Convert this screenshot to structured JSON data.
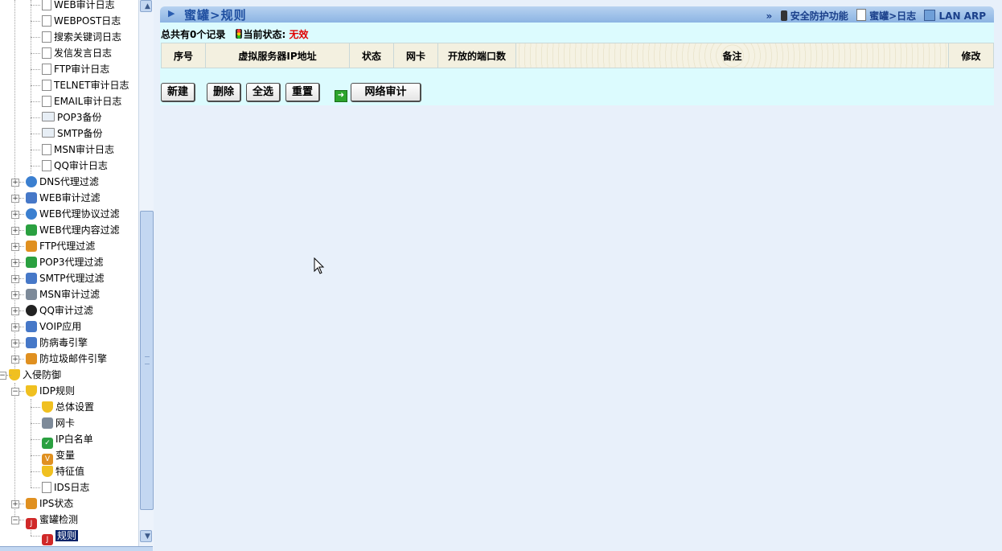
{
  "tree": {
    "items": [
      {
        "label": "WEB审计日志",
        "icon": "document-icon",
        "level": 3
      },
      {
        "label": "WEBPOST日志",
        "icon": "document-icon",
        "level": 3
      },
      {
        "label": "搜索关键词日志",
        "icon": "document-icon",
        "level": 3
      },
      {
        "label": "发信发言日志",
        "icon": "document-icon",
        "level": 3
      },
      {
        "label": "FTP审计日志",
        "icon": "document-icon",
        "level": 3
      },
      {
        "label": "TELNET审计日志",
        "icon": "document-icon",
        "level": 3
      },
      {
        "label": "EMAIL审计日志",
        "icon": "document-icon",
        "level": 3
      },
      {
        "label": "POP3备份",
        "icon": "envelope-icon",
        "level": 3
      },
      {
        "label": "SMTP备份",
        "icon": "envelope-icon",
        "level": 3
      },
      {
        "label": "MSN审计日志",
        "icon": "document-icon",
        "level": 3
      },
      {
        "label": "QQ审计日志",
        "icon": "document-icon",
        "level": 3
      },
      {
        "label": "DNS代理过滤",
        "icon": "globe-icon",
        "level": 2
      },
      {
        "label": "WEB审计过滤",
        "icon": "computer-icon",
        "level": 2
      },
      {
        "label": "WEB代理协议过滤",
        "icon": "globe-search-icon",
        "level": 2
      },
      {
        "label": "WEB代理内容过滤",
        "icon": "magnifier-icon",
        "level": 2
      },
      {
        "label": "FTP代理过滤",
        "icon": "ftp-icon",
        "level": 2
      },
      {
        "label": "POP3代理过滤",
        "icon": "mailbox-icon",
        "level": 2
      },
      {
        "label": "SMTP代理过滤",
        "icon": "mail-send-icon",
        "level": 2
      },
      {
        "label": "MSN审计过滤",
        "icon": "msn-user-icon",
        "level": 2
      },
      {
        "label": "QQ审计过滤",
        "icon": "qq-icon",
        "level": 2
      },
      {
        "label": "VOIP应用",
        "icon": "phone-icon",
        "level": 2
      },
      {
        "label": "防病毒引擎",
        "icon": "antivirus-shield-icon",
        "level": 2
      },
      {
        "label": "防垃圾邮件引擎",
        "icon": "antispam-icon",
        "level": 2
      },
      {
        "label": "入侵防御",
        "icon": "shield-icon",
        "level": 1
      },
      {
        "label": "IDP规则",
        "icon": "shield-icon",
        "level": 2
      },
      {
        "label": "总体设置",
        "icon": "shield-icon",
        "level": 3
      },
      {
        "label": "网卡",
        "icon": "network-card-icon",
        "level": 3
      },
      {
        "label": "IP白名单",
        "icon": "checkbox-icon",
        "level": 3
      },
      {
        "label": "变量",
        "icon": "variable-icon",
        "level": 3
      },
      {
        "label": "特征值",
        "icon": "signature-icon",
        "level": 3
      },
      {
        "label": "IDS日志",
        "icon": "document-icon",
        "level": 3
      },
      {
        "label": "IPS状态",
        "icon": "ips-status-icon",
        "level": 2
      },
      {
        "label": "蜜罐检测",
        "icon": "honeypot-icon",
        "level": 2
      },
      {
        "label": "规则",
        "icon": "honeypot-icon",
        "level": 3
      }
    ]
  },
  "header": {
    "title": "蜜罐>规则",
    "link_prefix": "»",
    "link_security": "安全防护功能",
    "link_log": "蜜罐>日志",
    "link_arp": "LAN ARP"
  },
  "summary": {
    "records_text": "总共有0个记录",
    "status_label": "当前状态:",
    "status_value": "无效",
    "status_color": "#e00000"
  },
  "table": {
    "columns": [
      "序号",
      "虚拟服务器IP地址",
      "状态",
      "网卡",
      "开放的端口数",
      "备注",
      "修改"
    ],
    "rows": []
  },
  "buttons": {
    "new": "新建",
    "delete": "删除",
    "select_all": "全选",
    "reset": "重置",
    "audit": "网络审计"
  },
  "colors": {
    "title_text": "#1f4fa0",
    "content_bg": "#dcfbfe",
    "page_bg": "#e8f0fa",
    "selection": "#0a246a"
  }
}
